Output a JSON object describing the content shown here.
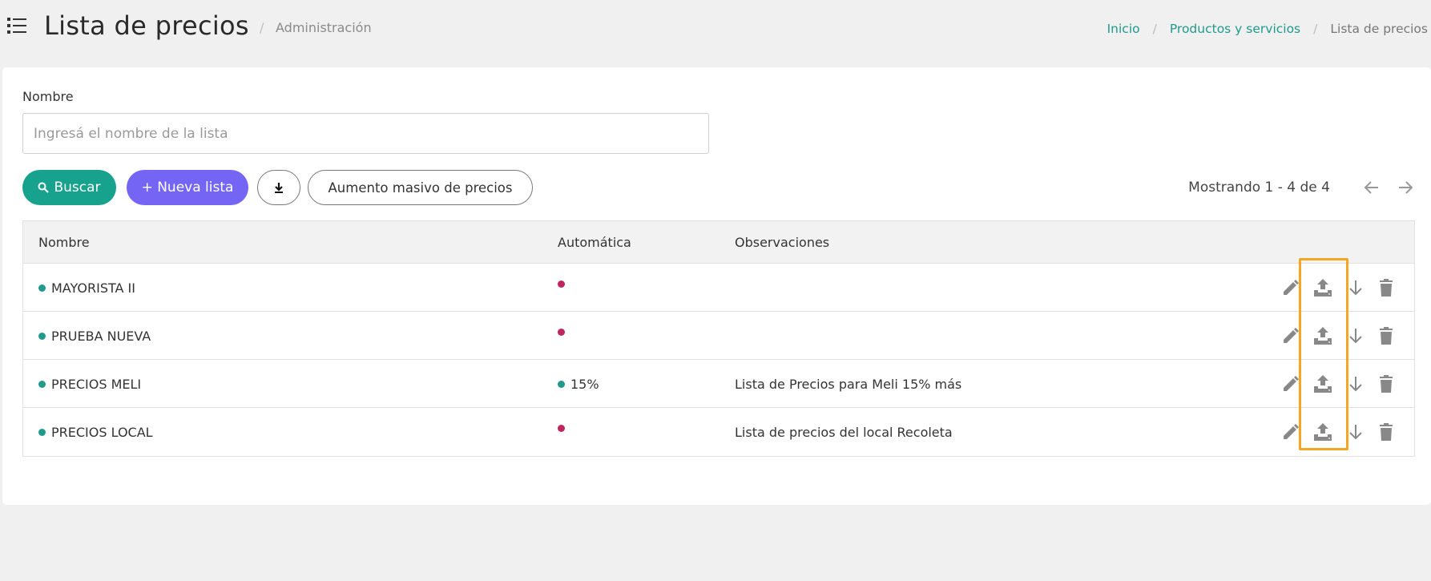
{
  "header": {
    "title": "Lista de precios",
    "section": "Administración",
    "breadcrumb": {
      "home": "Inicio",
      "parent": "Productos y servicios",
      "current": "Lista de precios"
    }
  },
  "filters": {
    "name_label": "Nombre",
    "name_placeholder": "Ingresá el nombre de la lista",
    "name_value": ""
  },
  "toolbar": {
    "search_label": "Buscar",
    "new_list_label": "+ Nueva lista",
    "mass_increase_label": "Aumento masivo de precios"
  },
  "pagination": {
    "text": "Mostrando 1 - 4 de 4"
  },
  "table": {
    "headers": {
      "name": "Nombre",
      "automatic": "Automática",
      "observations": "Observaciones"
    },
    "rows": [
      {
        "name": "MAYORISTA II",
        "automatic": "",
        "automatic_active": false,
        "observations": ""
      },
      {
        "name": "PRUEBA NUEVA",
        "automatic": "",
        "automatic_active": false,
        "observations": ""
      },
      {
        "name": "PRECIOS MELI",
        "automatic": "15%",
        "automatic_active": true,
        "observations": "Lista de Precios para Meli 15% más"
      },
      {
        "name": "PRECIOS LOCAL",
        "automatic": "",
        "automatic_active": false,
        "observations": "Lista de precios del local Recoleta"
      }
    ]
  },
  "icons": {
    "menu": "list-menu-icon",
    "search": "search-icon",
    "download": "download-icon",
    "prev": "arrow-left-icon",
    "next": "arrow-right-icon",
    "edit": "pencil-icon",
    "upload": "upload-icon",
    "sort": "arrow-down-icon",
    "delete": "trash-icon"
  },
  "colors": {
    "accent_teal": "#17a28e",
    "accent_purple": "#7565f5",
    "status_active": "#1f9a8c",
    "status_inactive": "#c0265e",
    "highlight": "#f5a623"
  }
}
